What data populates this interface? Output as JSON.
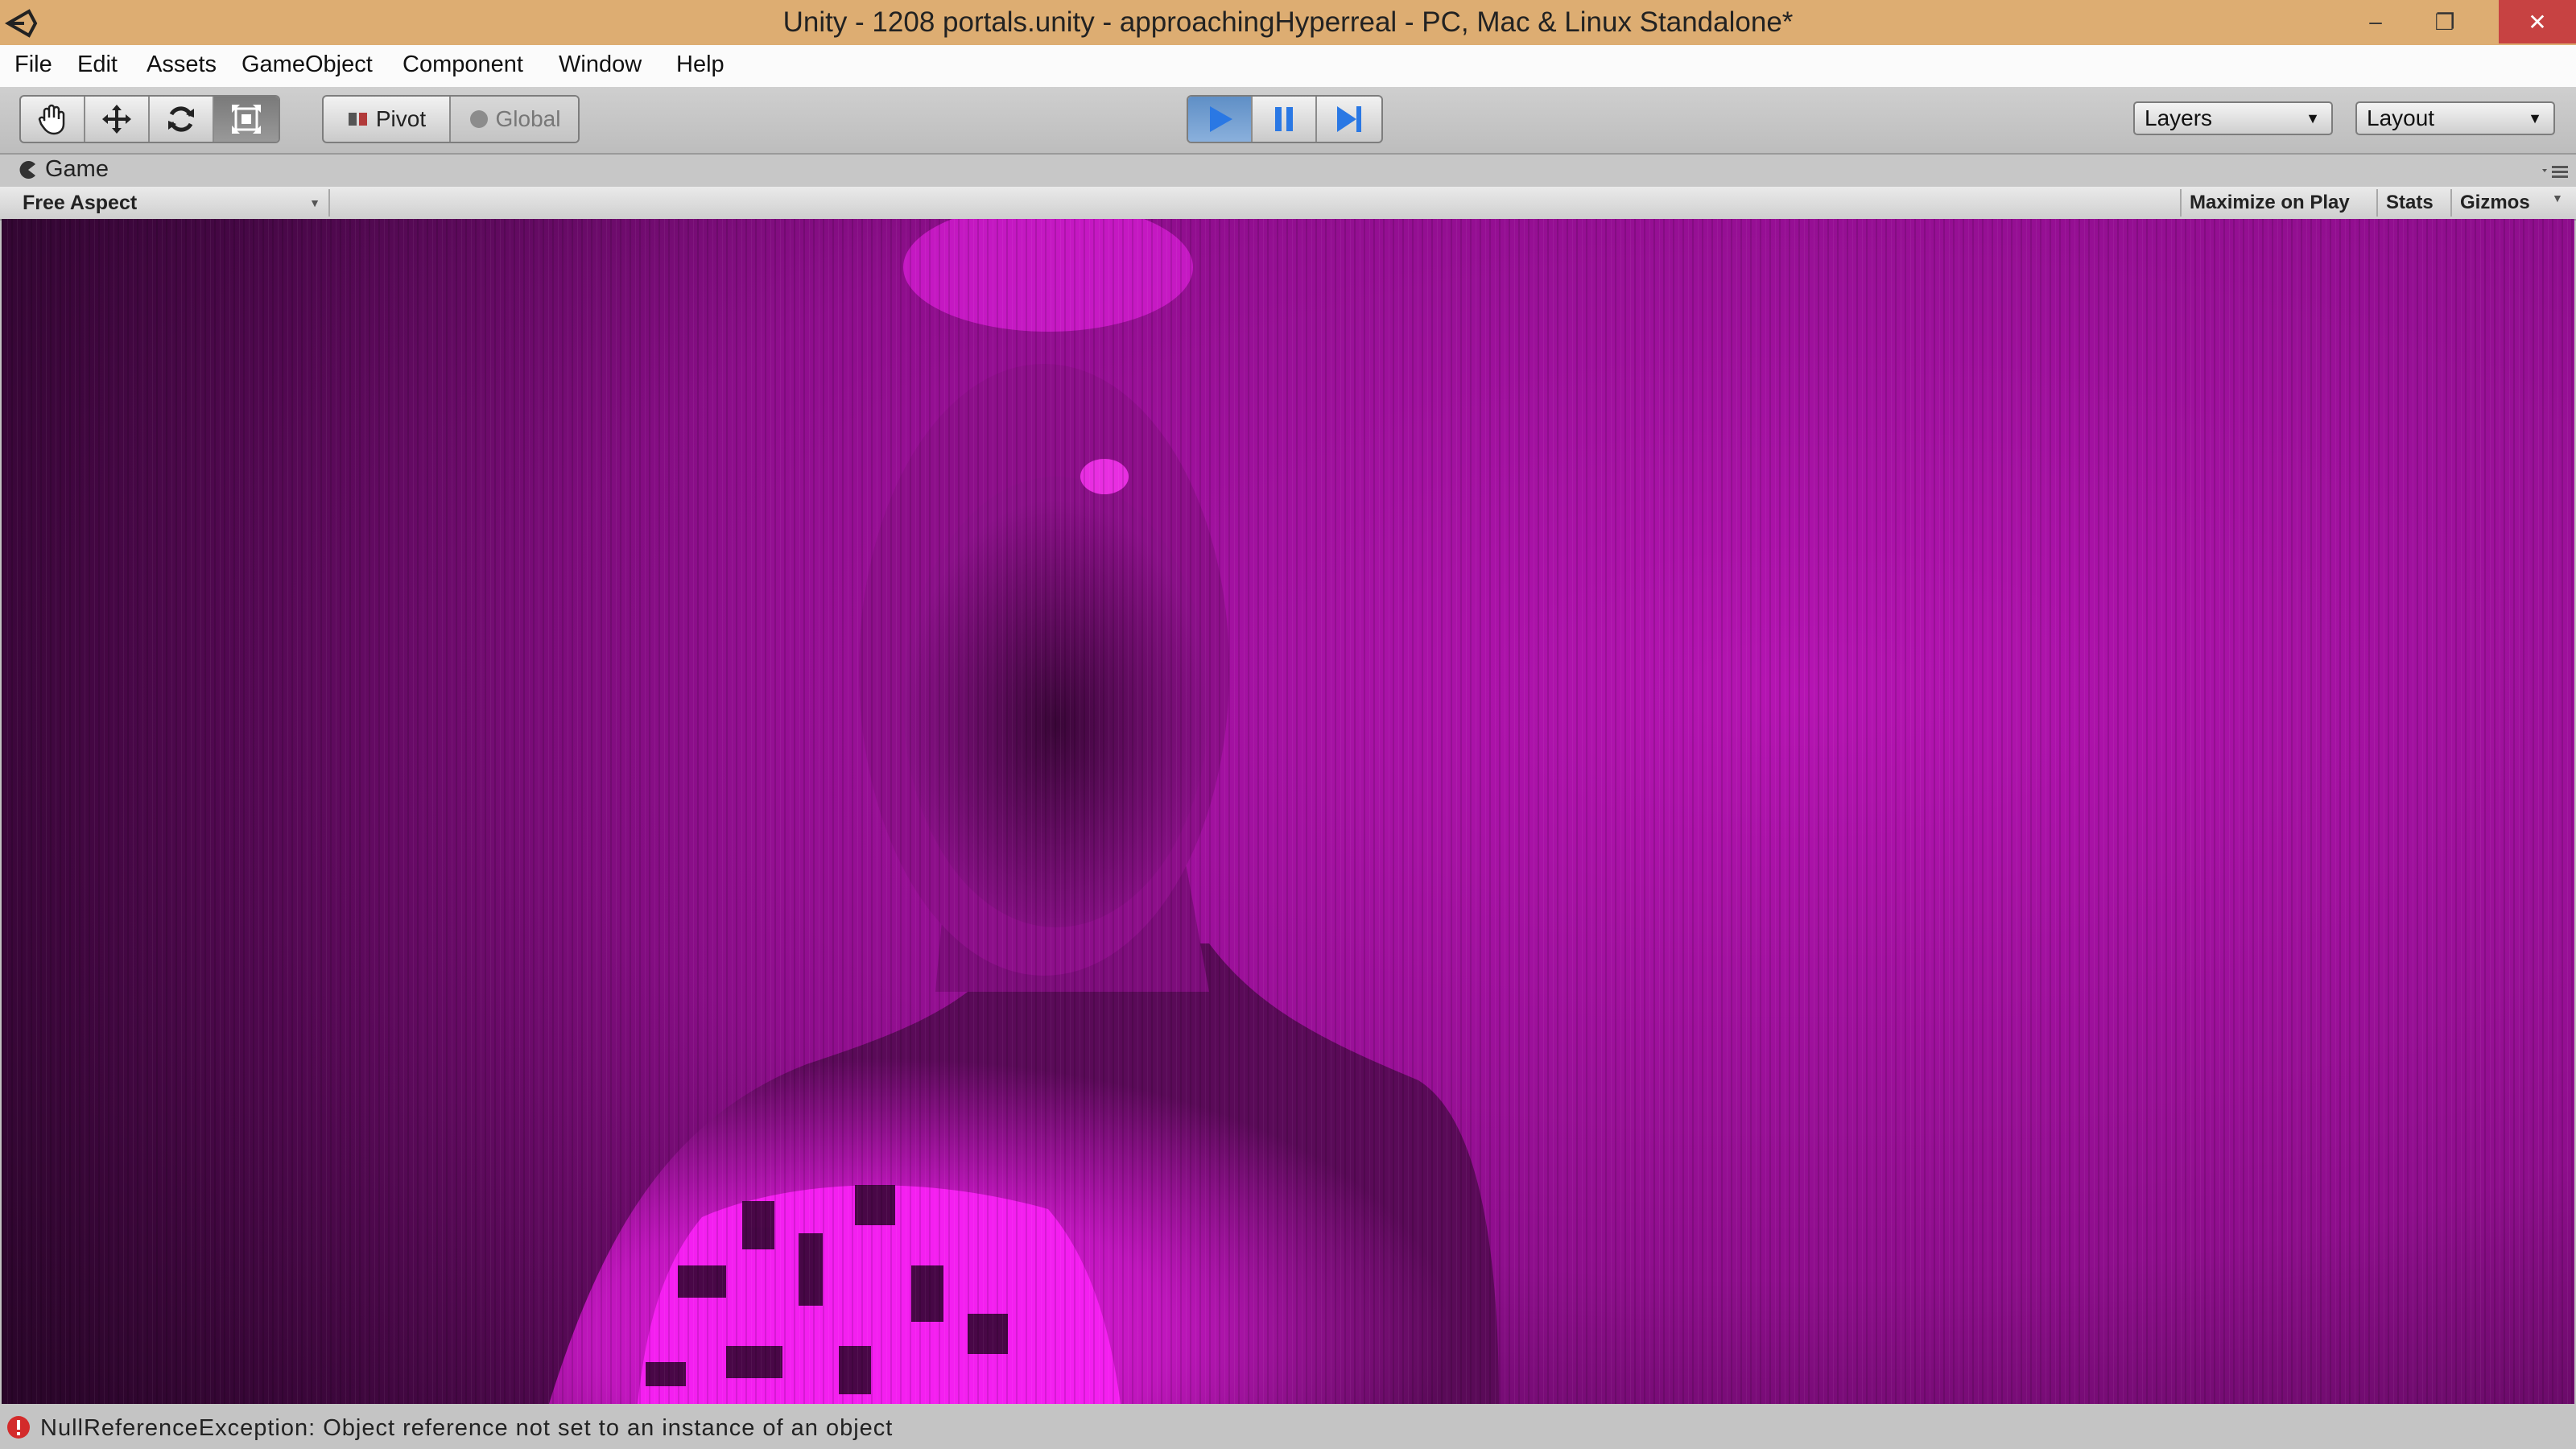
{
  "window": {
    "title": "Unity - 1208 portals.unity - approachingHyperreal - PC, Mac & Linux Standalone*",
    "minimize": "–",
    "restore": "❐",
    "close": "✕",
    "title_color": "#ddad72"
  },
  "menu": [
    "File",
    "Edit",
    "Assets",
    "GameObject",
    "Component",
    "Window",
    "Help"
  ],
  "toolbar": {
    "pivot_label": "Pivot",
    "global_label": "Global",
    "layers_label": "Layers",
    "layout_label": "Layout"
  },
  "game": {
    "tab_label": "Game",
    "aspect": "Free Aspect",
    "maximize": "Maximize on Play",
    "stats": "Stats",
    "gizmos": "Gizmos"
  },
  "status": {
    "message": "NullReferenceException: Object reference not set to an instance of an object"
  },
  "colors": {
    "scene_magenta": "#c218bf",
    "scene_dark": "#3a0939",
    "play_active": "#4a86d4"
  }
}
